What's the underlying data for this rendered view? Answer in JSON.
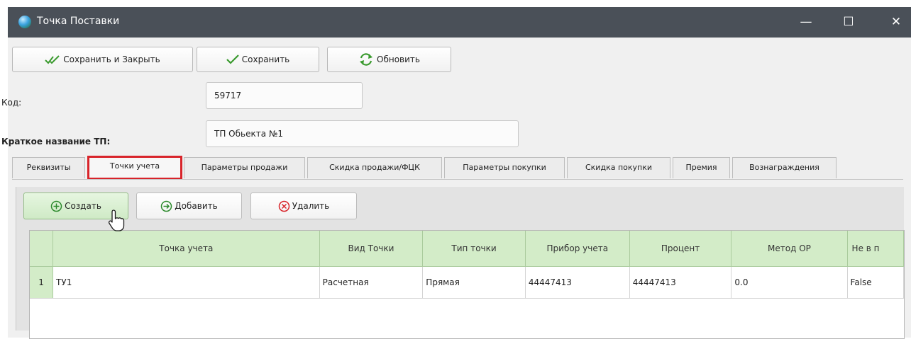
{
  "window": {
    "title": "Точка Поставки",
    "controls": {
      "minimize": "—",
      "maximize": "☐",
      "close": "✕"
    }
  },
  "toolbar": {
    "save_close_label": "Сохранить и Закрыть",
    "save_label": "Сохранить",
    "refresh_label": "Обновить"
  },
  "form": {
    "code_label": "Код:",
    "code_value": "59717",
    "name_label": "Краткое название ТП:",
    "name_value": "ТП Обьекта №1"
  },
  "tabs": [
    {
      "label": "Реквизиты"
    },
    {
      "label": "Точки учета",
      "active": true
    },
    {
      "label": "Параметры продажи"
    },
    {
      "label": "Скидка продажи/ФЦК"
    },
    {
      "label": "Параметры покупки"
    },
    {
      "label": "Скидка покупки"
    },
    {
      "label": "Премия"
    },
    {
      "label": "Вознаграждения"
    }
  ],
  "actions": {
    "create_label": "Создать",
    "add_label": "Добавить",
    "delete_label": "Удалить"
  },
  "grid": {
    "columns": [
      "Точка учета",
      "Вид Точки",
      "Тип точки",
      "Прибор учета",
      "Процент",
      "Метод ОР",
      "Не в п"
    ],
    "rows": [
      {
        "num": "1",
        "cells": [
          "ТУ1",
          "Расчетная",
          "Прямая",
          "44447413",
          "44447413",
          "0.0",
          "False"
        ]
      }
    ]
  },
  "colors": {
    "titlebar": "#4a5058",
    "grid_header": "#d3ecc8",
    "tab_highlight": "#d8242a",
    "check_icon": "#3a9a2e",
    "delete_icon": "#d8242a"
  }
}
